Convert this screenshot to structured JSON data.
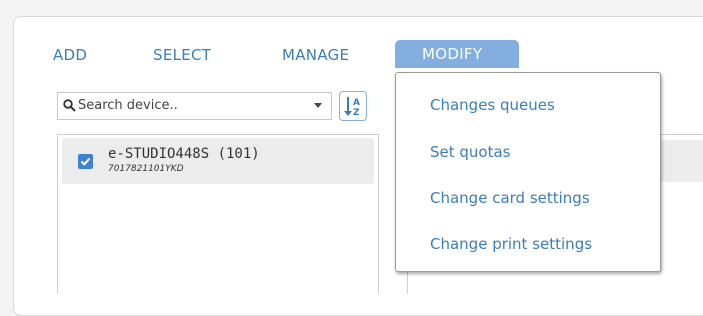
{
  "nav": {
    "add_label": "ADD",
    "select_label": "SELECT",
    "manage_label": "MANAGE",
    "modify_label": "MODIFY"
  },
  "search": {
    "placeholder": "Search device.."
  },
  "devices": [
    {
      "name": "e-STUDIO448S (101)",
      "serial": "7017821101YKD",
      "checked": true
    }
  ],
  "modify_menu": {
    "items": [
      {
        "label": "Changes queues"
      },
      {
        "label": "Set quotas"
      },
      {
        "label": "Change card settings"
      },
      {
        "label": "Change print settings"
      }
    ]
  },
  "colors": {
    "accent": "#3b7db7",
    "active_tab": "#82aee0",
    "checkbox": "#3f82d1"
  },
  "icons": {
    "search": "search-icon",
    "dropdown": "chevron-down-icon",
    "sort": "sort-az-icon",
    "checkbox": "checkmark-icon"
  }
}
